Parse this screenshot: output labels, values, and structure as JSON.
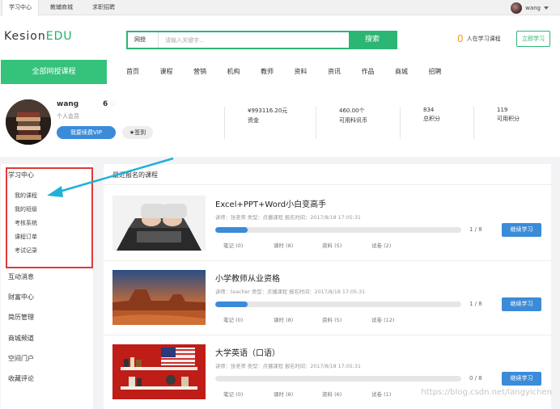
{
  "topbar": {
    "tabs": [
      {
        "label": "学习中心",
        "active": true
      },
      {
        "label": "教辅商城",
        "active": false
      },
      {
        "label": "求职招聘",
        "active": false
      }
    ],
    "user": "wang"
  },
  "header": {
    "logo_a": "Kesion",
    "logo_b": "EDU",
    "search_scope": "网授",
    "search_placeholder": "请输入关键字...",
    "search_button": "搜索",
    "learning_count": "0",
    "learning_text": "人在学习课程",
    "learn_now": "立即学习"
  },
  "nav": {
    "all_courses": "全部网授课程",
    "items": [
      "首页",
      "课程",
      "营销",
      "机构",
      "教师",
      "资料",
      "资讯",
      "作品",
      "商城",
      "招聘"
    ]
  },
  "profile": {
    "name": "wang",
    "level": "个人会员",
    "number": "6",
    "vip_button": "我要续费VIP",
    "sign_button": "★签到",
    "stats": [
      {
        "value": "¥993116.20元",
        "label": "资金"
      },
      {
        "value": "460.00个",
        "label": "可用科讯币"
      },
      {
        "value": "834",
        "label": "总积分"
      },
      {
        "value": "119",
        "label": "可用积分"
      }
    ]
  },
  "sidebar": {
    "heading": "学习中心",
    "sub_items": [
      "我的课程",
      "我的班级",
      "考核系统",
      "课程订单",
      "考试记录"
    ],
    "main_items": [
      "互动消息",
      "财富中心",
      "简历管理",
      "商城频道",
      "空间门户",
      "收藏评论"
    ]
  },
  "content": {
    "title": "最近报名的课程",
    "continue_label": "继续学习",
    "courses": [
      {
        "title": "Excel+PPT+Word小白变高手",
        "meta": "讲师：张老师      类型：点播课程      报名时间：2017/8/18 17:05:31",
        "progress": 0.13,
        "frac": "1 / 8",
        "links": [
          "笔记 (0)",
          "课时 (8)",
          "资料 (5)",
          "试卷 (2)"
        ]
      },
      {
        "title": "小学教师从业资格",
        "meta": "讲师：teacher      类型：点播课程      报名时间：2017/8/18 17:05:31",
        "progress": 0.13,
        "frac": "1 / 8",
        "links": [
          "笔记 (0)",
          "课时 (8)",
          "资料 (5)",
          "试卷 (12)"
        ]
      },
      {
        "title": "大学英语（口语）",
        "meta": "讲师：张老师      类型：点播课程      报名时间：2017/8/18 17:05:31",
        "progress": 0,
        "frac": "0 / 8",
        "links": [
          "笔记 (0)",
          "课时 (8)",
          "资料 (6)",
          "试卷 (1)"
        ]
      }
    ]
  },
  "watermark": "https://blog.csdn.net/langyichen",
  "colors": {
    "green": "#2bb673",
    "blue": "#3b8bd8",
    "annotation_red": "#e03a3a",
    "arrow_cyan": "#1fb1d8"
  }
}
